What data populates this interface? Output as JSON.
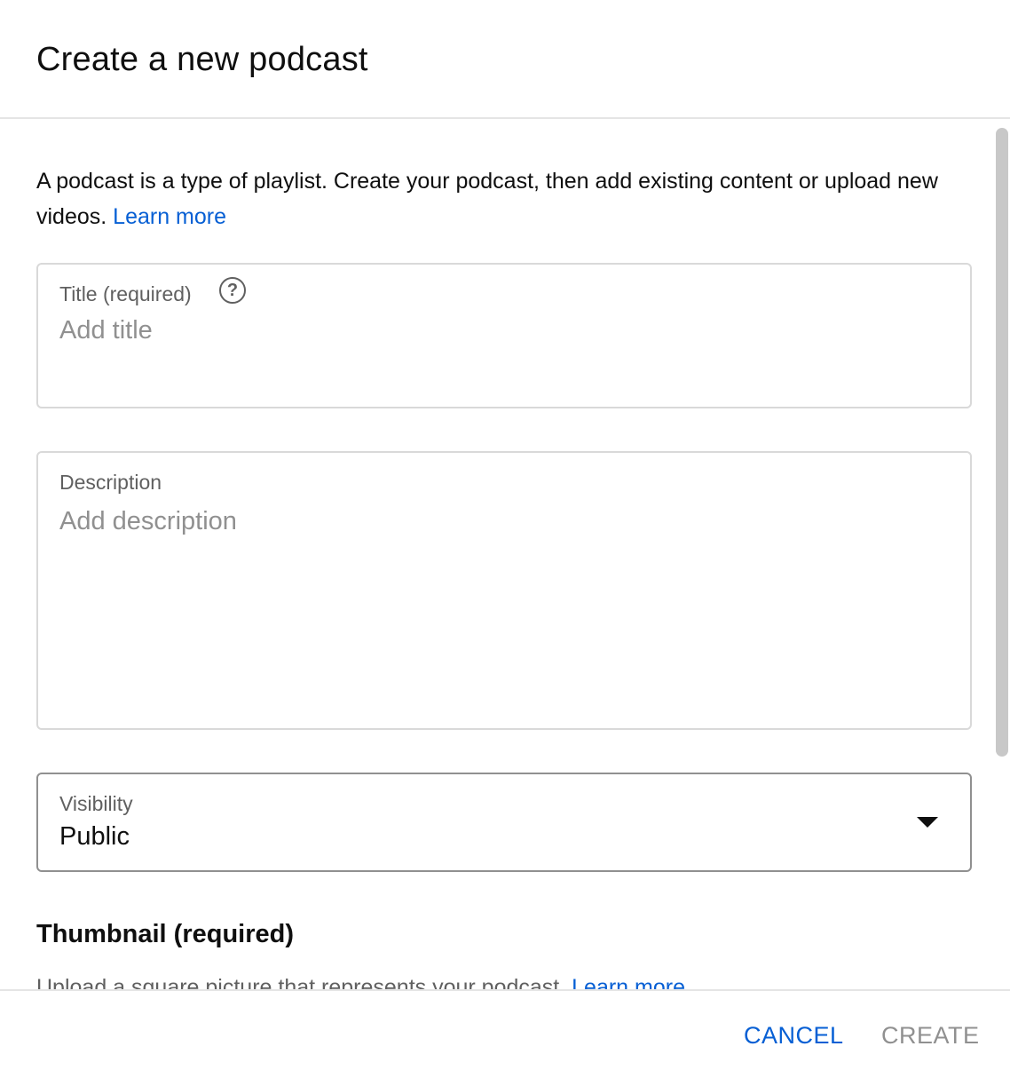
{
  "dialog": {
    "title": "Create a new podcast"
  },
  "intro": {
    "text": "A podcast is a type of playlist. Create your podcast, then add existing content or upload new videos.",
    "link_label": "Learn more"
  },
  "title_field": {
    "label": "Title (required)",
    "help_glyph": "?",
    "placeholder": "Add title",
    "value": ""
  },
  "description_field": {
    "label": "Description",
    "placeholder": "Add description",
    "value": ""
  },
  "visibility_field": {
    "label": "Visibility",
    "selected": "Public"
  },
  "thumbnail": {
    "heading": "Thumbnail (required)",
    "text": "Upload a square picture that represents your podcast.",
    "link_label": "Learn more"
  },
  "footer": {
    "cancel_label": "CANCEL",
    "create_label": "CREATE"
  },
  "colors": {
    "link": "#065fd4",
    "disabled": "#909090",
    "border": "#d9d9d9"
  },
  "icons": {
    "help": "help-circle-icon",
    "dropdown": "caret-down-icon"
  }
}
